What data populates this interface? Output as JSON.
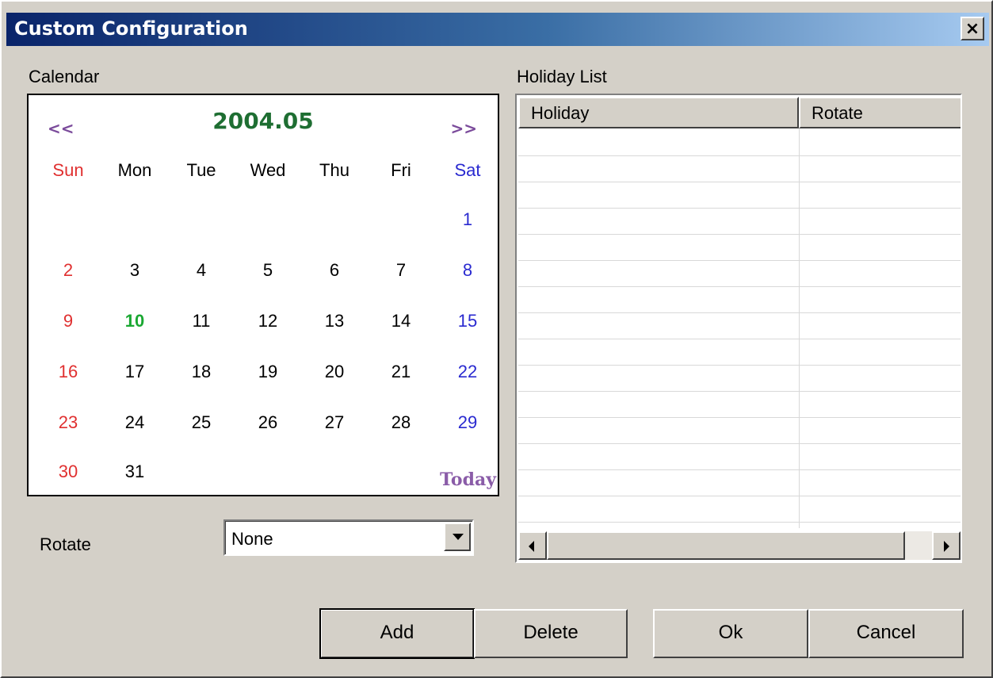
{
  "window": {
    "title": "Custom Configuration",
    "close_glyph": "×"
  },
  "labels": {
    "calendar": "Calendar",
    "holiday_list": "Holiday List",
    "rotate": "Rotate"
  },
  "calendar": {
    "prev": "<<",
    "next": ">>",
    "month_title": "2004.05",
    "today_label": "Today",
    "weekdays": [
      "Sun",
      "Mon",
      "Tue",
      "Wed",
      "Thu",
      "Fri",
      "Sat"
    ],
    "weeks": [
      [
        "",
        "",
        "",
        "",
        "",
        "",
        "1"
      ],
      [
        "2",
        "3",
        "4",
        "5",
        "6",
        "7",
        "8"
      ],
      [
        "9",
        "10",
        "11",
        "12",
        "13",
        "14",
        "15"
      ],
      [
        "16",
        "17",
        "18",
        "19",
        "20",
        "21",
        "22"
      ],
      [
        "23",
        "24",
        "25",
        "26",
        "27",
        "28",
        "29"
      ],
      [
        "30",
        "31",
        "",
        "",
        "",
        "",
        ""
      ]
    ],
    "highlighted_day": "10",
    "colors": {
      "sunday": "#e03030",
      "saturday": "#2a2ad0",
      "highlight": "#1aa832",
      "title": "#1e6e32",
      "nav": "#7b4b9b"
    }
  },
  "rotate_select": {
    "value": "None"
  },
  "holiday_list": {
    "columns": [
      "Holiday",
      "Rotate"
    ],
    "rows": []
  },
  "buttons": {
    "add": "Add",
    "delete": "Delete",
    "ok": "Ok",
    "cancel": "Cancel"
  }
}
